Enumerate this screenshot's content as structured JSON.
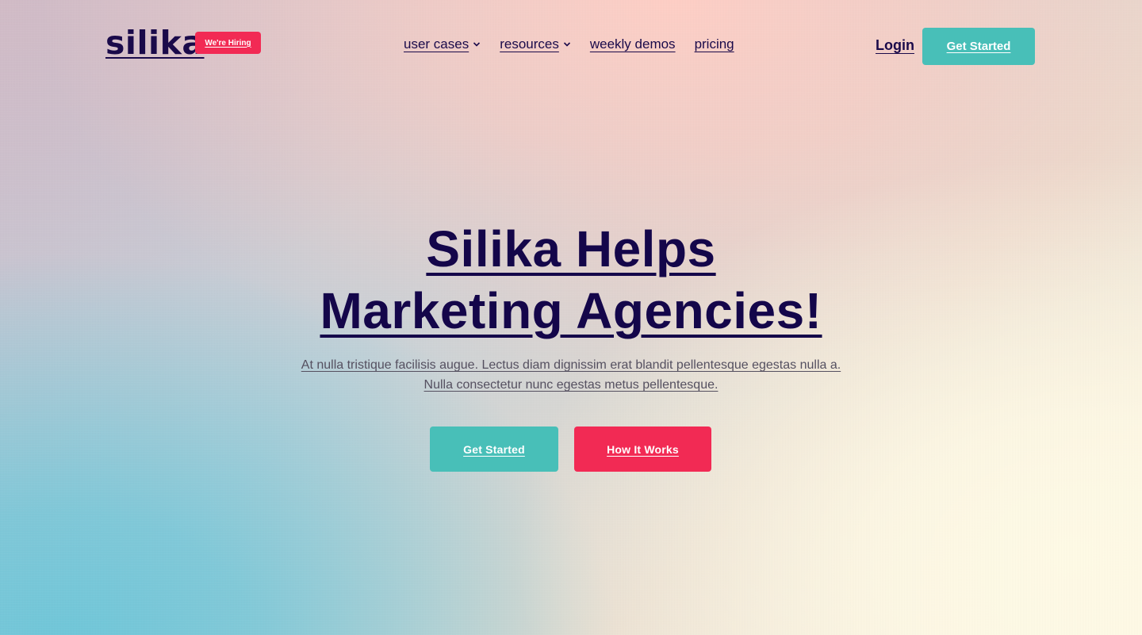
{
  "brand": {
    "logo_text": "silika",
    "hiring_badge": "We're Hiring"
  },
  "nav": {
    "items": [
      {
        "label": "user cases",
        "has_dropdown": true,
        "icon": "chevron-down-icon"
      },
      {
        "label": "resources",
        "has_dropdown": true,
        "icon": "chevron-down-icon"
      },
      {
        "label": "weekly demos",
        "has_dropdown": false
      },
      {
        "label": "pricing",
        "has_dropdown": false
      }
    ]
  },
  "header_actions": {
    "login_label": "Login",
    "get_started_label": "Get Started"
  },
  "hero": {
    "title_line1": "Silika Helps",
    "title_line2": "Marketing Agencies!",
    "subtitle": "At nulla tristique facilisis augue. Lectus diam dignissim erat blandit pellentesque egestas nulla a. Nulla consectetur nunc egestas metus pellentesque.",
    "primary_button": "Get Started",
    "secondary_button": "How It Works"
  },
  "colors": {
    "text_primary": "#14064a",
    "accent_teal": "#48bfb8",
    "accent_red": "#f22a54"
  }
}
